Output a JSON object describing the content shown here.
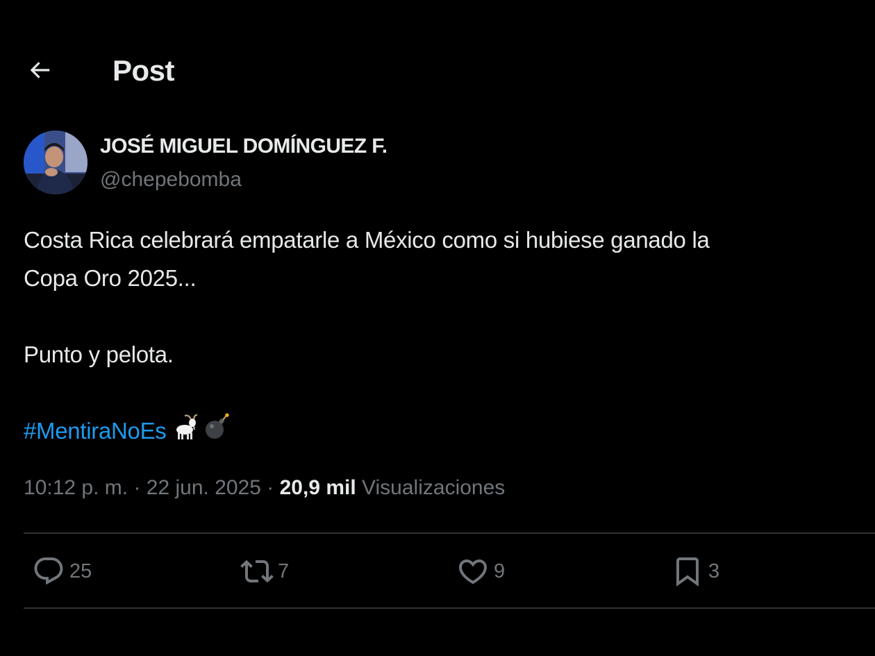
{
  "header": {
    "back_icon": "arrow-left-icon",
    "title": "Post"
  },
  "author": {
    "name": "JOSÉ MIGUEL DOMÍNGUEZ F.",
    "handle": "@chepebomba",
    "avatar_icon": "profile-photo"
  },
  "post": {
    "line1": "Costa Rica celebrará empatarle a México como si hubiese ganado la",
    "line2": "Copa Oro 2025...",
    "line3": "Punto y pelota.",
    "hashtag": "#MentiraNoEs",
    "emojis": [
      "goat-emoji",
      "bomb-emoji"
    ]
  },
  "meta": {
    "time": "10:12 p. m.",
    "separator": "·",
    "date": "22 jun. 2025",
    "views_count": "20,9 mil",
    "views_label": "Visualizaciones"
  },
  "actions": {
    "replies": {
      "icon": "reply-icon",
      "count": "25"
    },
    "reposts": {
      "icon": "repost-icon",
      "count": "7"
    },
    "likes": {
      "icon": "heart-icon",
      "count": "9"
    },
    "bookmarks": {
      "icon": "bookmark-icon",
      "count": "3"
    }
  },
  "colors": {
    "background": "#000000",
    "text": "#e7e9ea",
    "secondary": "#71767b",
    "accent": "#1d9bf0",
    "divider": "#2f3336"
  }
}
